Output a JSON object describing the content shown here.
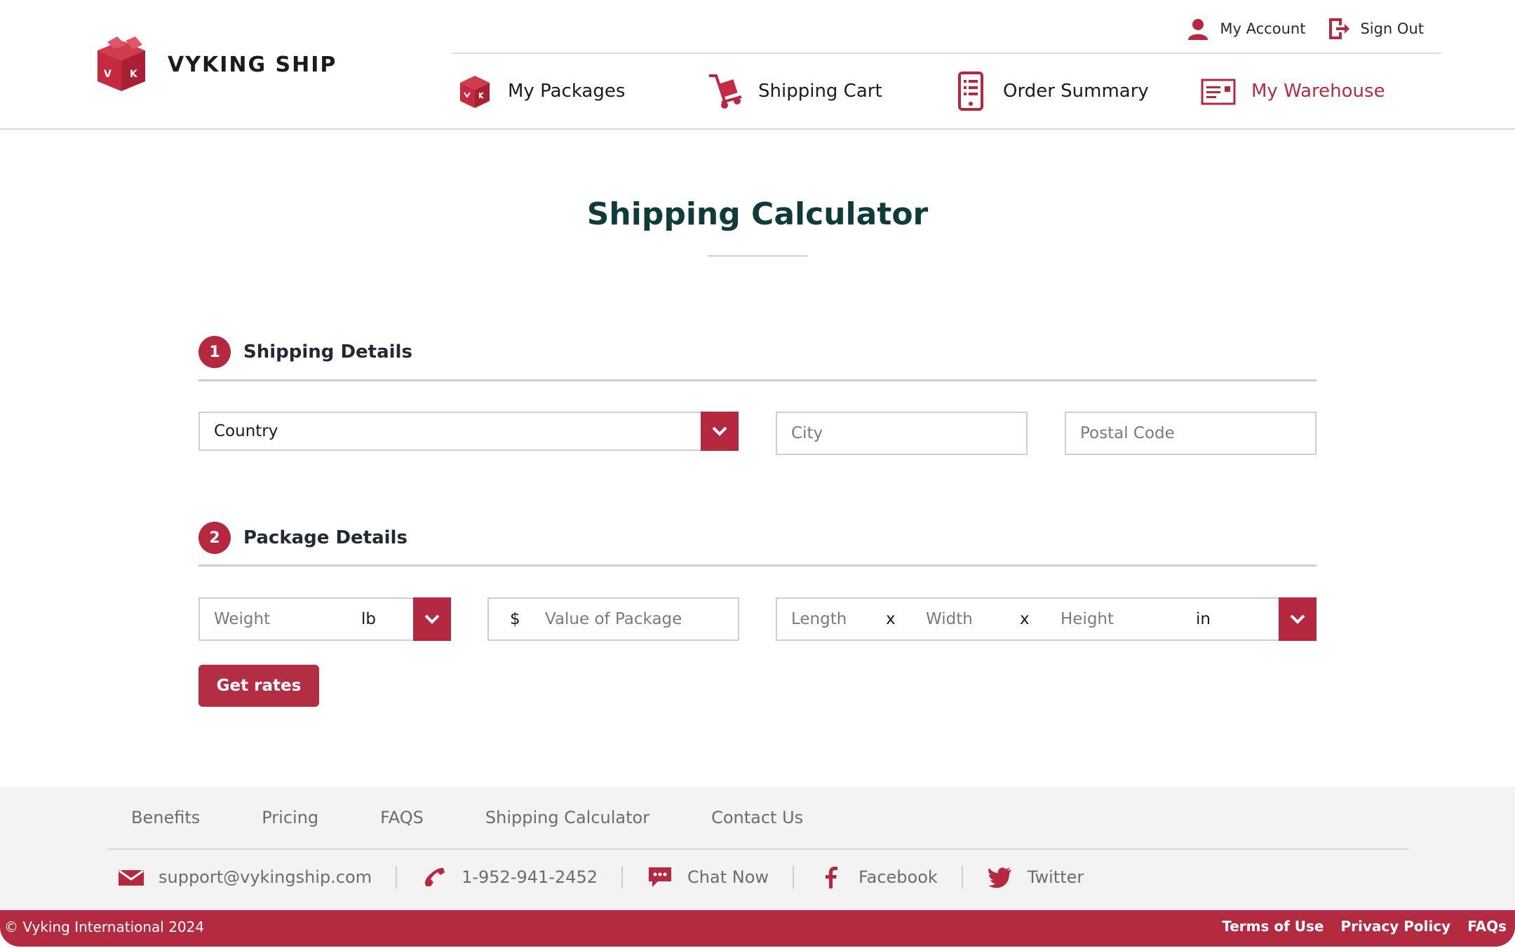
{
  "brand": {
    "name": "VYKING SHIP",
    "logo_letters": "VK",
    "accent": "#b52840"
  },
  "account_links": [
    {
      "label": "My Account",
      "icon": "user-icon"
    },
    {
      "label": "Sign Out",
      "icon": "sign-out-icon"
    }
  ],
  "nav": [
    {
      "label": "My Packages",
      "icon": "package-icon",
      "active": false
    },
    {
      "label": "Shipping Cart",
      "icon": "hand-truck-icon",
      "active": false
    },
    {
      "label": "Order Summary",
      "icon": "order-list-icon",
      "active": false
    },
    {
      "label": "My Warehouse",
      "icon": "warehouse-card-icon",
      "active": true
    }
  ],
  "page": {
    "title": "Shipping Calculator"
  },
  "shipping_details": {
    "step": "1",
    "label": "Shipping Details",
    "country_value": "Country",
    "city_placeholder": "City",
    "postal_placeholder": "Postal Code"
  },
  "package_details": {
    "step": "2",
    "label": "Package Details",
    "weight_placeholder": "Weight",
    "weight_unit": "lb",
    "currency_symbol": "$",
    "value_placeholder": "Value of Package",
    "length_placeholder": "Length",
    "width_placeholder": "Width",
    "height_placeholder": "Height",
    "times_sign": "x",
    "dimension_unit": "in"
  },
  "get_rates_label": "Get rates",
  "footer": {
    "nav": [
      "Benefits",
      "Pricing",
      "FAQS",
      "Shipping Calculator",
      "Contact Us"
    ],
    "contacts": [
      {
        "label": "support@vykingship.com",
        "icon": "mail-icon"
      },
      {
        "label": "1-952-941-2452",
        "icon": "phone-icon"
      },
      {
        "label": "Chat Now",
        "icon": "chat-icon"
      },
      {
        "label": "Facebook",
        "icon": "facebook-icon"
      },
      {
        "label": "Twitter",
        "icon": "twitter-icon"
      }
    ],
    "copyright": "© Vyking International 2024",
    "legal": [
      "Terms of Use",
      "Privacy Policy",
      "FAQs"
    ]
  }
}
